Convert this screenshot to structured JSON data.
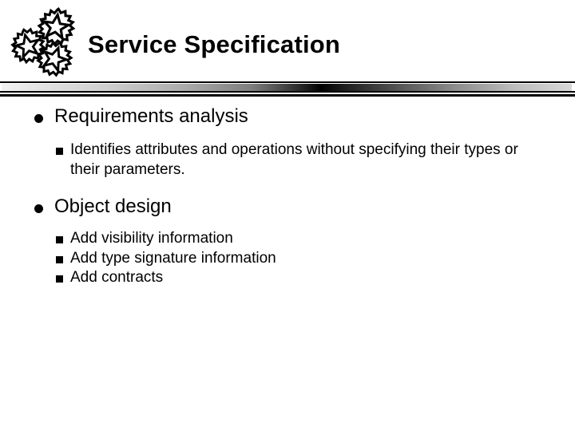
{
  "slide": {
    "title": "Service Specification",
    "logo_icon": "gear-stars-logo-icon",
    "bullets": [
      {
        "marker": "round-bullet",
        "text": "Requirements analysis",
        "sub_marker": "square-bullet",
        "sub_items": [
          "Identifies attributes and operations without specifying their types or their parameters."
        ]
      },
      {
        "marker": "round-bullet",
        "text": "Object design",
        "sub_marker": "square-bullet",
        "sub_items": [
          "Add visibility information",
          "Add type signature information",
          "Add contracts"
        ]
      }
    ]
  },
  "colors": {
    "background": "#ffffff",
    "text": "#000000",
    "divider_light": "#f2f2f2",
    "divider_dark": "#000000"
  }
}
